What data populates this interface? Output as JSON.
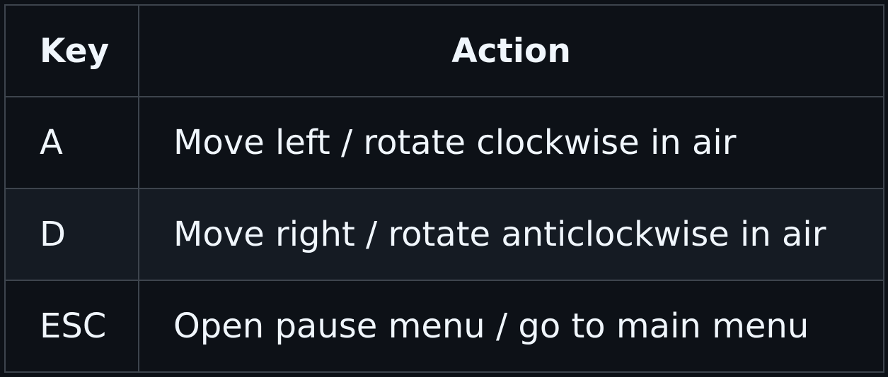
{
  "table": {
    "headers": {
      "key": "Key",
      "action": "Action"
    },
    "rows": [
      {
        "key": "A",
        "action": "Move left / rotate clockwise in air"
      },
      {
        "key": "D",
        "action": "Move right / rotate anticlockwise in air"
      },
      {
        "key": "ESC",
        "action": "Open pause menu / go to main menu"
      }
    ]
  },
  "colors": {
    "background": "#0d1117",
    "row_alt_background": "#151b23",
    "border": "#3d444d",
    "text": "#f0f6fc"
  }
}
